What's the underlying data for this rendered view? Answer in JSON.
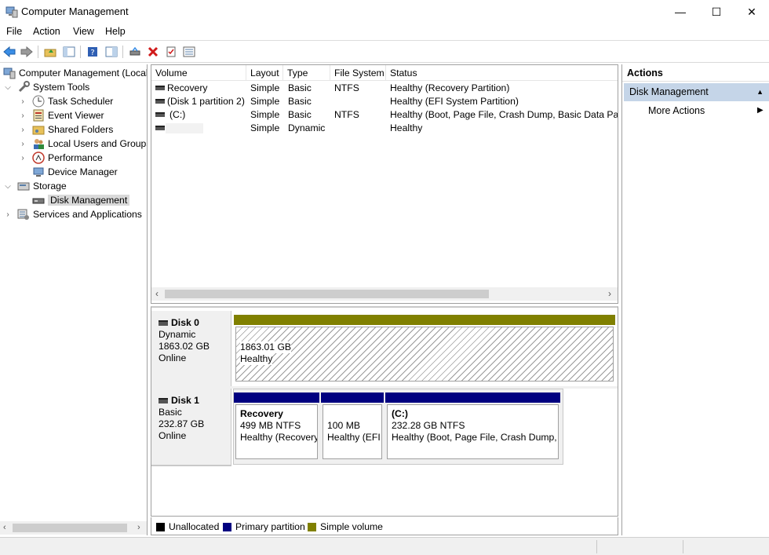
{
  "window": {
    "title": "Computer Management",
    "minimize": "—",
    "maximize": "☐",
    "close": "✕"
  },
  "menu": [
    "File",
    "Action",
    "View",
    "Help"
  ],
  "tree": {
    "root": "Computer Management (Local",
    "system_tools": "System Tools",
    "task_scheduler": "Task Scheduler",
    "event_viewer": "Event Viewer",
    "shared_folders": "Shared Folders",
    "local_users": "Local Users and Groups",
    "performance": "Performance",
    "device_manager": "Device Manager",
    "storage": "Storage",
    "disk_management": "Disk Management",
    "services": "Services and Applications"
  },
  "volumes": {
    "columns": [
      "Volume",
      "Layout",
      "Type",
      "File System",
      "Status"
    ],
    "rows": [
      {
        "volume": "Recovery",
        "layout": "Simple",
        "type": "Basic",
        "fs": "NTFS",
        "status": "Healthy (Recovery Partition)"
      },
      {
        "volume": "(Disk 1 partition 2)",
        "layout": "Simple",
        "type": "Basic",
        "fs": "",
        "status": "Healthy (EFI System Partition)"
      },
      {
        "volume": "(C:)",
        "layout": "Simple",
        "type": "Basic",
        "fs": "NTFS",
        "status": "Healthy (Boot, Page File, Crash Dump, Basic Data Partit"
      },
      {
        "volume": "",
        "layout": "Simple",
        "type": "Dynamic",
        "fs": "",
        "status": "Healthy"
      }
    ]
  },
  "disks": {
    "disk0": {
      "name": "Disk 0",
      "type": "Dynamic",
      "size": "1863.02 GB",
      "state": "Online",
      "part_size": "1863.01 GB",
      "part_status": "Healthy"
    },
    "disk1": {
      "name": "Disk 1",
      "type": "Basic",
      "size": "232.87 GB",
      "state": "Online",
      "p1_name": "Recovery",
      "p1_size": "499 MB NTFS",
      "p1_status": "Healthy (Recovery",
      "p2_size": "100 MB",
      "p2_status": "Healthy (EFI",
      "p3_name": "(C:)",
      "p3_size": "232.28 GB NTFS",
      "p3_status": "Healthy (Boot, Page File, Crash Dump, E"
    }
  },
  "legend": {
    "unallocated": "Unallocated",
    "primary": "Primary partition",
    "simple": "Simple volume"
  },
  "colors": {
    "unallocated": "#000000",
    "primary": "#000080",
    "simple": "#808000",
    "selection": "#c5d5e8"
  },
  "actions": {
    "header": "Actions",
    "section": "Disk Management",
    "more": "More Actions"
  }
}
